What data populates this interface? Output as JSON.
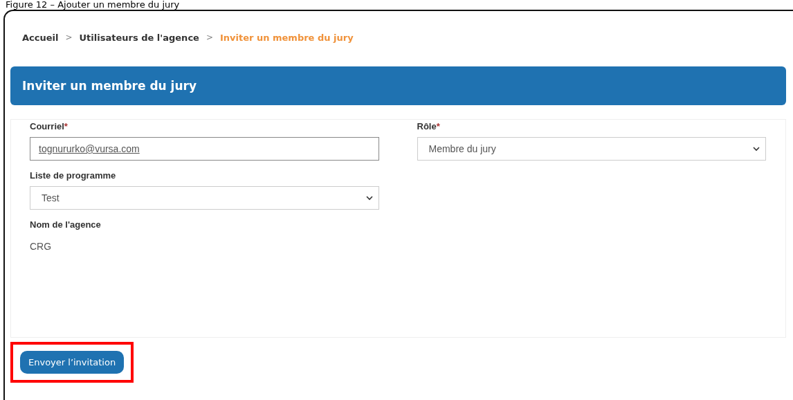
{
  "caption": "Figure 12 – Ajouter un membre du jury",
  "breadcrumb": [
    {
      "label": "Accueil",
      "current": false
    },
    {
      "label": "Utilisateurs de l'agence",
      "current": false
    },
    {
      "label": "Inviter un membre du jury",
      "current": true
    }
  ],
  "separators": [
    ">",
    ">"
  ],
  "header": {
    "title": "Inviter un membre du jury"
  },
  "left_fields": [
    {
      "kind": "input",
      "label": "Courriel",
      "required": true,
      "value": "tognururko@vursa.com"
    },
    {
      "kind": "select",
      "label": "Liste de programme",
      "required": false,
      "value": "Test"
    },
    {
      "kind": "text",
      "label": "Nom de l'agence",
      "required": false,
      "value": "CRG"
    }
  ],
  "right_fields": [
    {
      "kind": "select",
      "label": "Rôle",
      "required": true,
      "value": "Membre du jury"
    }
  ],
  "required_mark": "*",
  "submit": {
    "label": "Envoyer l’invitation",
    "highlighted": true
  }
}
